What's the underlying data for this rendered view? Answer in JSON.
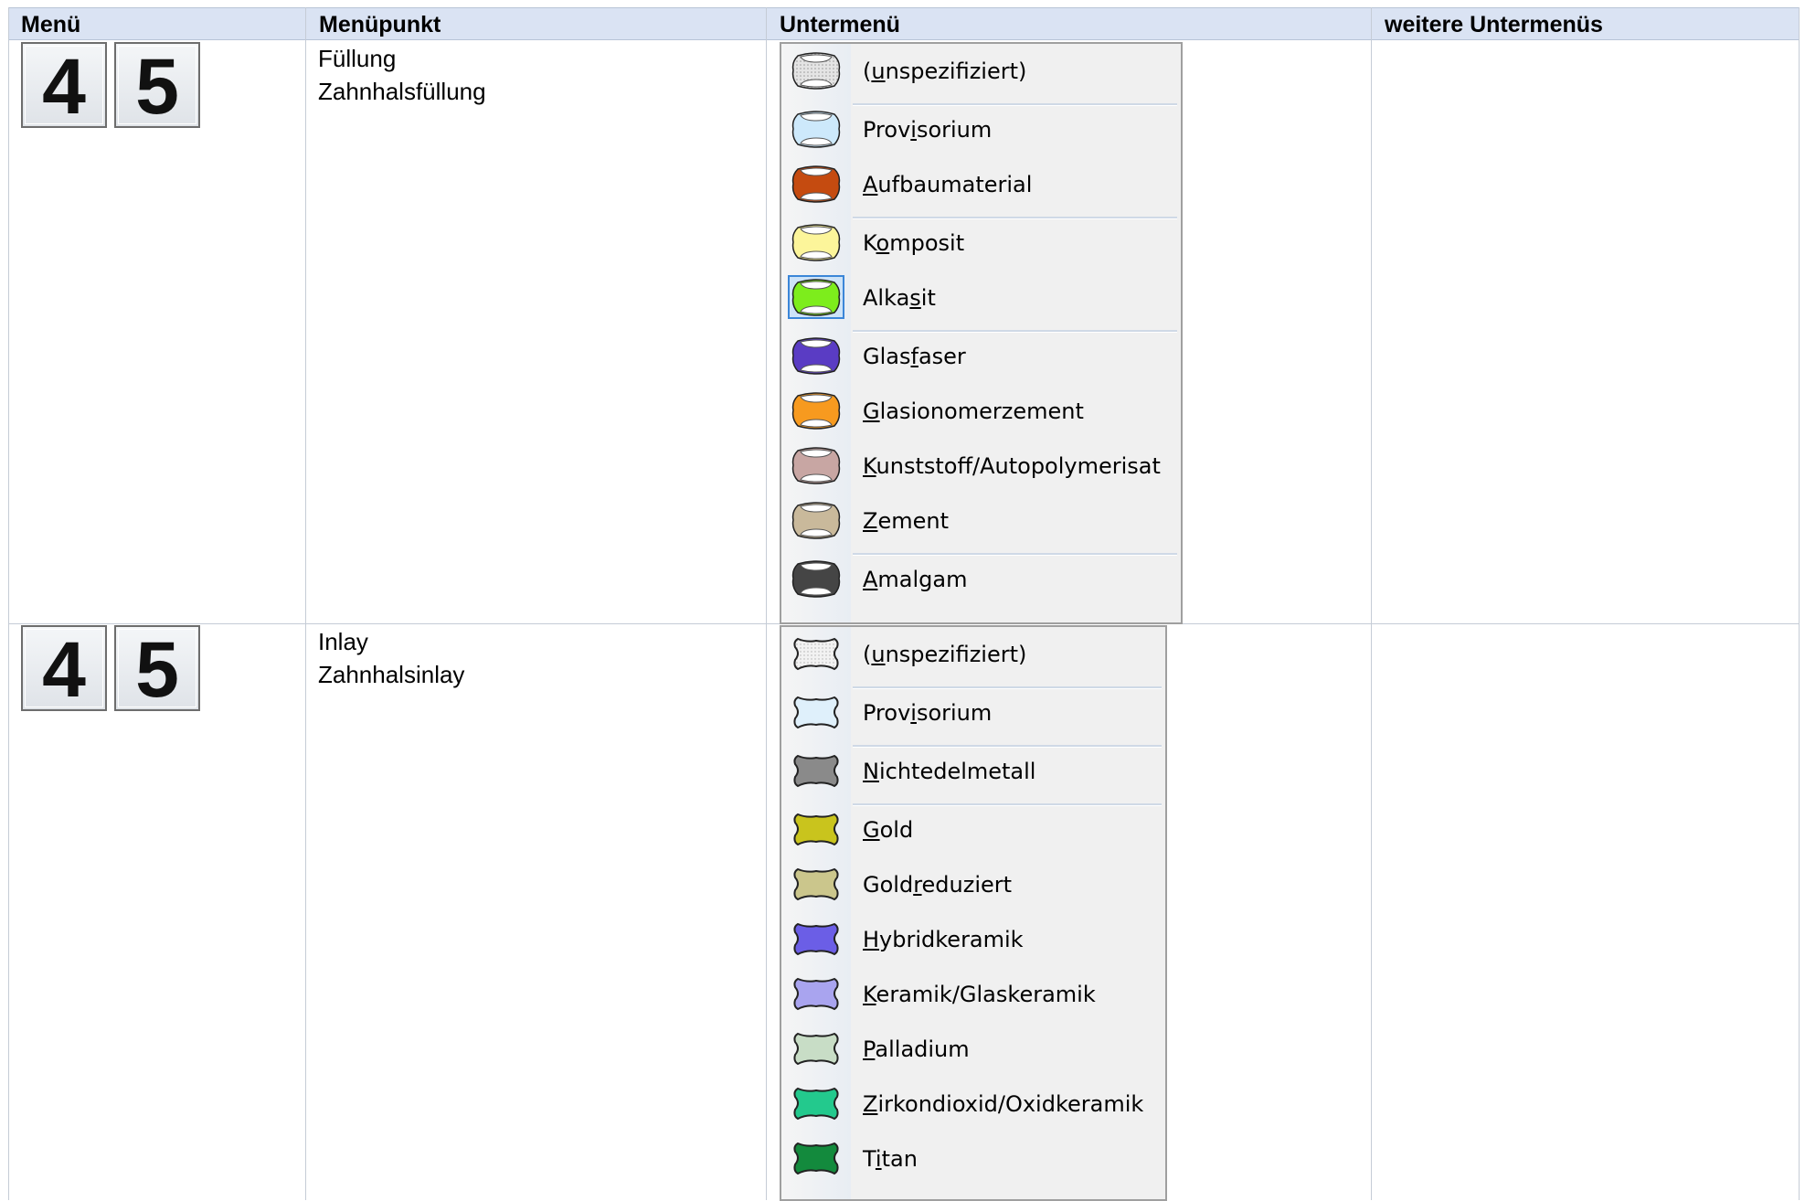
{
  "table": {
    "headers": [
      "Menü",
      "Menüpunkt",
      "Untermenü",
      "weitere Untermenüs"
    ]
  },
  "rows": [
    {
      "tooth_digits": [
        "4",
        "5"
      ],
      "menu_items": [
        "Füllung",
        "Zahnhalsfüllung"
      ],
      "submenu": [
        {
          "label": "(unspezifiziert)",
          "mnemonic_index": 1,
          "color": "#d7d7d7",
          "pattern": "dots",
          "sep_before": false
        },
        {
          "label": "Provisorium",
          "mnemonic_index": 4,
          "color": "#cde9fb",
          "sep_before": true
        },
        {
          "label": "Aufbaumaterial",
          "mnemonic_index": 0,
          "color": "#c54b10",
          "sep_before": false
        },
        {
          "label": "Komposit",
          "mnemonic_index": 1,
          "color": "#fcf59a",
          "sep_before": true
        },
        {
          "label": "Alkasit",
          "mnemonic_index": 4,
          "color": "#7ded1c",
          "sep_before": false,
          "selected": true
        },
        {
          "label": "Glasfaser",
          "mnemonic_index": 4,
          "color": "#5a3cc4",
          "sep_before": true
        },
        {
          "label": "Glasionomerzement",
          "mnemonic_index": 0,
          "color": "#f79a1f",
          "sep_before": false
        },
        {
          "label": "Kunststoff/Autopolymerisat",
          "mnemonic_index": 0,
          "color": "#c8a6a3",
          "sep_before": false
        },
        {
          "label": "Zement",
          "mnemonic_index": 0,
          "color": "#c9b99b",
          "sep_before": false
        },
        {
          "label": "Amalgam",
          "mnemonic_index": 0,
          "color": "#454545",
          "sep_before": true
        }
      ]
    },
    {
      "tooth_digits": [
        "4",
        "5"
      ],
      "menu_items": [
        "Inlay",
        "Zahnhalsinlay"
      ],
      "submenu": [
        {
          "label": "(unspezifiziert)",
          "mnemonic_index": 1,
          "color": "#e8e8e8",
          "pattern": "dots",
          "sep_before": false
        },
        {
          "label": "Provisorium",
          "mnemonic_index": 4,
          "color": "#dff0fb",
          "sep_before": true
        },
        {
          "label": "Nichtedelmetall",
          "mnemonic_index": 0,
          "color": "#8a8a8a",
          "sep_before": true
        },
        {
          "label": "Gold",
          "mnemonic_index": 0,
          "color": "#c9c41d",
          "sep_before": true
        },
        {
          "label": "Goldreduziert",
          "mnemonic_index": 4,
          "color": "#cbc68c",
          "sep_before": false
        },
        {
          "label": "Hybridkeramik",
          "mnemonic_index": 0,
          "color": "#6b5ee6",
          "sep_before": false
        },
        {
          "label": "Keramik/Glaskeramik",
          "mnemonic_index": 0,
          "color": "#a9a4ef",
          "sep_before": false
        },
        {
          "label": "Palladium",
          "mnemonic_index": 0,
          "color": "#c8ddc6",
          "sep_before": false
        },
        {
          "label": "Zirkondioxid/Oxidkeramik",
          "mnemonic_index": 0,
          "color": "#23c98d",
          "sep_before": false
        },
        {
          "label": "Titan",
          "mnemonic_index": 1,
          "color": "#138a3d",
          "sep_before": false
        }
      ]
    }
  ]
}
